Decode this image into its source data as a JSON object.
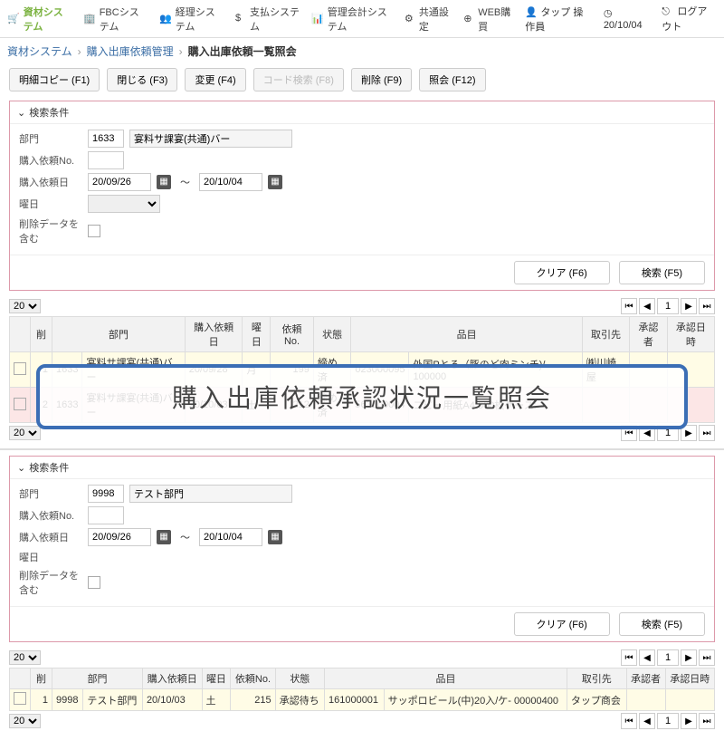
{
  "topnav": {
    "items": [
      {
        "label": "資材システム"
      },
      {
        "label": "FBCシステム"
      },
      {
        "label": "経理システム"
      },
      {
        "label": "支払システム"
      },
      {
        "label": "管理会計システム"
      },
      {
        "label": "共通設定"
      },
      {
        "label": "WEB購買"
      }
    ],
    "user": "タップ 操作員",
    "date": "20/10/04",
    "logout": "ログアウト"
  },
  "breadcrumb": {
    "items": [
      "資材システム",
      "購入出庫依頼管理"
    ],
    "current": "購入出庫依頼一覧照会"
  },
  "actions": {
    "copy": "明細コピー (F1)",
    "close": "閉じる (F3)",
    "change": "変更 (F4)",
    "codesearch": "コード検索 (F8)",
    "delete": "削除 (F9)",
    "query": "照会 (F12)"
  },
  "search": {
    "title": "検索条件",
    "labels": {
      "dept": "部門",
      "reqno": "購入依頼No.",
      "reqdate": "購入依頼日",
      "dow": "曜日",
      "includeDeleted": "削除データを含む"
    },
    "clear": "クリア (F6)",
    "exec": "検索 (F5)"
  },
  "upper": {
    "dept_code": "1633",
    "dept_name": "宴料サ課宴(共通)バー",
    "date_from": "20/09/26",
    "date_to": "20/10/04"
  },
  "lower": {
    "dept_code": "9998",
    "dept_name": "テスト部門",
    "date_from": "20/09/26",
    "date_to": "20/10/04"
  },
  "pagesize": "20",
  "page": "1",
  "grid": {
    "headers": {
      "del": "削",
      "dept": "部門",
      "reqdate": "購入依頼日",
      "dow": "曜日",
      "reqno": "依頼No.",
      "status": "状態",
      "item": "品目",
      "vendor": "取引先",
      "approver": "承認者",
      "approvedate": "承認日時"
    }
  },
  "rows_upper": [
    {
      "no": "1",
      "dept_code": "1633",
      "dept_name": "宴料サ課宴(共通)バー",
      "reqdate": "20/09/28",
      "dow": "月",
      "reqno": "199",
      "status": "締め済",
      "item_code": "023000095",
      "item_name": "外国Pとろ（豚のど肉ミンチ)/ 100000",
      "vendor": "㈱川崎屋"
    },
    {
      "no": "2",
      "dept_code": "1633",
      "dept_name": "宴料サ課宴(共通)バー",
      "reqdate": "20/10/03",
      "dow": "土",
      "reqno": "212",
      "status": "締め済",
      "item_code": "563000004",
      "item_name": "コピー用紙A4 500枚ケース:",
      "vendor": ""
    }
  ],
  "rows_lower": [
    {
      "no": "1",
      "dept_code": "9998",
      "dept_name": "テスト部門",
      "reqdate": "20/10/03",
      "dow": "土",
      "reqno": "215",
      "status": "承認待ち",
      "item_code": "161000001",
      "item_name": "サッポロビール(中)20入/ケ- 00000400",
      "vendor": "タップ商会"
    }
  ],
  "overlay_title": "購入出庫依頼承認状況一覧照会"
}
